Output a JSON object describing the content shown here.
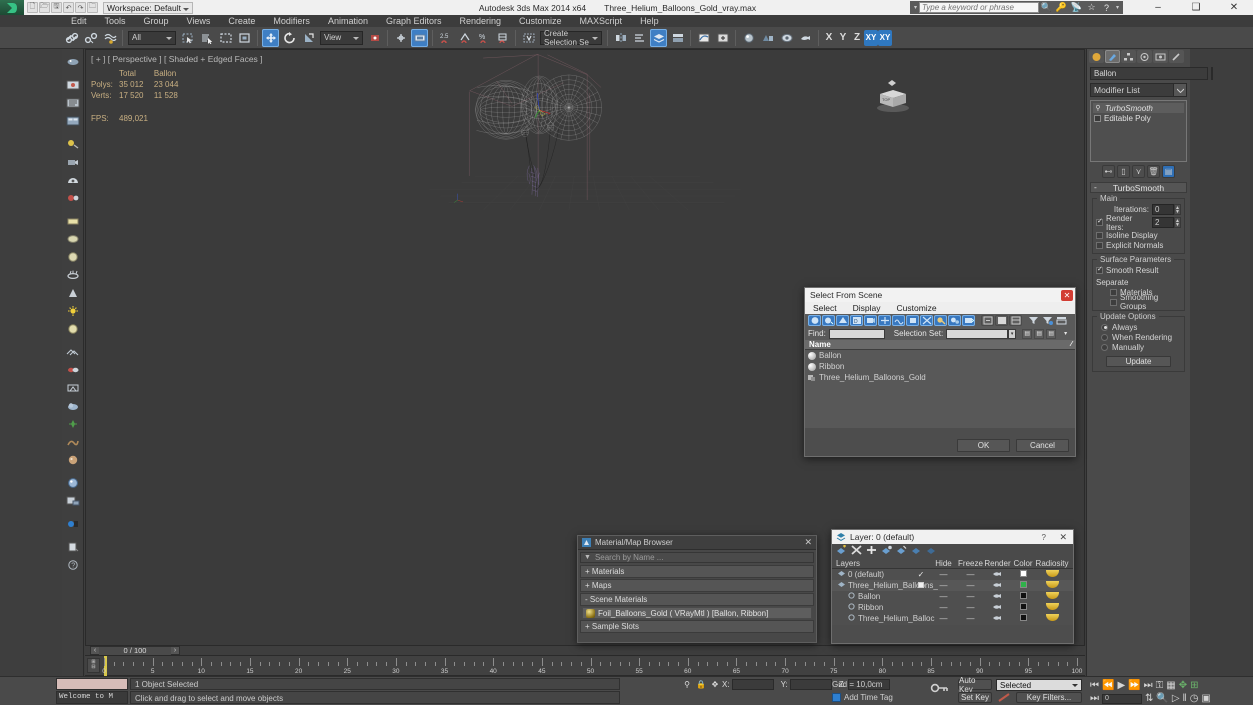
{
  "titlebar": {
    "app_title": "Autodesk 3ds Max  2014 x64",
    "file_name": "Three_Helium_Balloons_Gold_vray.max",
    "workspace": "Workspace: Default",
    "search_placeholder": "Type a keyword or phrase",
    "minimize": "–",
    "maximize": "❑",
    "close": "✕"
  },
  "menu": {
    "items": [
      "Edit",
      "Tools",
      "Group",
      "Views",
      "Create",
      "Modifiers",
      "Animation",
      "Graph Editors",
      "Rendering",
      "Customize",
      "MAXScript",
      "Help"
    ]
  },
  "toolbar": {
    "selection_filter": "All",
    "ref_coord_system": "View",
    "named_selection_sets": "Create Selection Se",
    "axis_x": "X",
    "axis_y": "Y",
    "axis_z": "Z",
    "axis_xy": "XY",
    "axis_xy_cycle": "XY"
  },
  "viewport": {
    "label": "[ + ] [ Perspective ] [ Shaded + Edged Faces ]",
    "stats": {
      "col_total": "Total",
      "col_object": "Ballon",
      "rows": [
        {
          "label": "Polys:",
          "total": "35 012",
          "object": "23 044"
        },
        {
          "label": "Verts:",
          "total": "17 520",
          "object": "11 528"
        }
      ],
      "fps_label": "FPS:",
      "fps_value": "489,021"
    }
  },
  "command_panel": {
    "object_name": "Ballon",
    "modifier_list_label": "Modifier List",
    "stack": [
      {
        "label": "TurboSmooth",
        "selected": true
      },
      {
        "label": "Editable Poly",
        "selected": false
      }
    ],
    "rollout_title": "TurboSmooth",
    "main_group": "Main",
    "iterations_label": "Iterations:",
    "iterations_value": "0",
    "render_iters_label": "Render Iters:",
    "render_iters_value": "2",
    "isoline_display": "Isoline Display",
    "explicit_normals": "Explicit Normals",
    "surface_params_group": "Surface Parameters",
    "smooth_result": "Smooth Result",
    "separate_label": "Separate",
    "separate_materials": "Materials",
    "separate_smoothing_groups": "Smoothing Groups",
    "update_options_group": "Update Options",
    "update_always": "Always",
    "update_when_rendering": "When Rendering",
    "update_manually": "Manually",
    "update_button": "Update"
  },
  "select_from_scene": {
    "title": "Select From Scene",
    "menu": [
      "Select",
      "Display",
      "Customize"
    ],
    "find_label": "Find:",
    "find_value": "",
    "selection_set_label": "Selection Set:",
    "selection_set_value": "",
    "column_header": "Name",
    "rows": [
      {
        "name": "Ballon",
        "type": "object"
      },
      {
        "name": "Ribbon",
        "type": "object"
      },
      {
        "name": "Three_Helium_Balloons_Gold",
        "type": "group"
      }
    ],
    "ok": "OK",
    "cancel": "Cancel",
    "close": "✕"
  },
  "material_browser": {
    "title": "Material/Map Browser",
    "search_placeholder": "Search by Name ...",
    "groups": [
      {
        "label": "+ Materials"
      },
      {
        "label": "+ Maps"
      },
      {
        "label": "- Scene Materials"
      },
      {
        "label": "+ Sample Slots"
      }
    ],
    "scene_material": "Foil_Balloons_Gold  ( VRayMtl )  [Ballon, Ribbon]",
    "close": "✕"
  },
  "layer_dialog": {
    "title": "Layer: 0 (default)",
    "help": "?",
    "close": "✕",
    "columns": [
      "Layers",
      "Hide",
      "Freeze",
      "Render",
      "Color",
      "Radiosity"
    ],
    "rows": [
      {
        "name": "0 (default)",
        "indent": 0,
        "current": true,
        "hide": "—",
        "freeze": "—",
        "color": "#ffffff"
      },
      {
        "name": "Three_Helium_Balloons_",
        "indent": 0,
        "current": false,
        "hide": "—",
        "freeze": "—",
        "color": "#2fb24a"
      },
      {
        "name": "Ballon",
        "indent": 1,
        "current": false,
        "hide": "—",
        "freeze": "—",
        "color": "#111111"
      },
      {
        "name": "Ribbon",
        "indent": 1,
        "current": false,
        "hide": "—",
        "freeze": "—",
        "color": "#111111"
      },
      {
        "name": "Three_Helium_Balloc",
        "indent": 1,
        "current": false,
        "hide": "—",
        "freeze": "—",
        "color": "#111111"
      }
    ]
  },
  "timeline": {
    "current_frame": "0 / 100",
    "prev_arrow": "‹",
    "next_arrow": "›",
    "ticks": [
      0,
      5,
      10,
      15,
      20,
      25,
      30,
      35,
      40,
      45,
      50,
      55,
      60,
      65,
      70,
      75,
      80,
      85,
      90,
      95,
      100
    ]
  },
  "status_bar": {
    "listener_text": "Welcome to M",
    "selection_status": "1 Object Selected",
    "prompt": "Click and drag to select and move objects",
    "coord_x_label": "X:",
    "coord_y_label": "Y:",
    "coord_z_label": "Z:",
    "coord_x": "",
    "coord_y": "",
    "coord_z": "",
    "grid_label": "Grid = 10,0cm",
    "add_time_tag": "Add Time Tag",
    "auto_key": "Auto Key",
    "set_key": "Set Key",
    "key_filters": "Key Filters...",
    "key_mode": "Selected",
    "key_frame_value": "0"
  },
  "colors": {
    "accent_blue": "#3878c0",
    "title_red": "#d23c33",
    "viewport_bg": "#3b3b3b",
    "grid_pink": "#9b6a77",
    "key_yellow": "#d8c84a",
    "panel_gray": "#4a4a4a"
  }
}
